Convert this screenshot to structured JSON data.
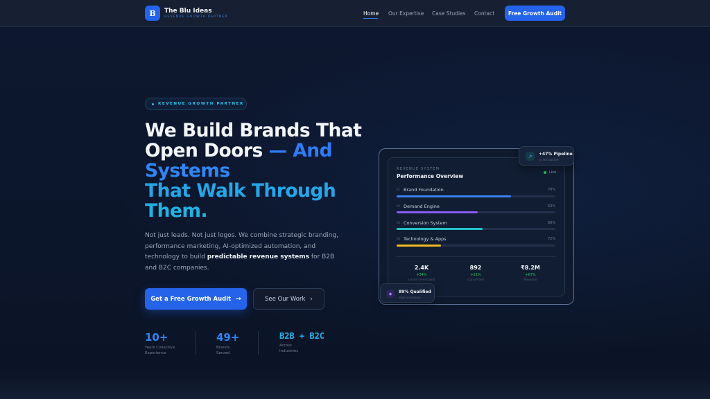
{
  "nav": {
    "logo_letter": "B",
    "brand_name": "The Blu Ideas",
    "brand_tagline": "REVENUE GROWTH PARTNER",
    "links": [
      {
        "label": "Home",
        "active": true
      },
      {
        "label": "Our Expertise",
        "active": false
      },
      {
        "label": "Case Studies",
        "active": false
      },
      {
        "label": "Contact",
        "active": false
      }
    ],
    "cta_label": "Free Growth Audit"
  },
  "hero": {
    "eyebrow": "REVENUE GROWTH PARTNER",
    "headline_line1": "We Build Brands That",
    "headline_line2_a": "Open Doors ",
    "headline_line2_b": "— And",
    "headline_line3": "Systems",
    "headline_line4": "That Walk Through",
    "headline_line5": "Them.",
    "paragraph_a": "Not just leads. Not just logos. We combine strategic branding, performance marketing, AI-optimized automation, and technology to build ",
    "paragraph_bold": "predictable revenue systems",
    "paragraph_b": " for B2B and B2C companies.",
    "primary_cta": "Get a Free Growth Audit",
    "secondary_cta": "See Our Work",
    "arrow_icon": "→",
    "chevron_icon": "›"
  },
  "stats": [
    {
      "value": "10+",
      "label": "Years Collective Experience",
      "color": "#2f86f6"
    },
    {
      "value": "49+",
      "label": "Brands Served",
      "color": "#2f86f6"
    },
    {
      "value": "B2B + B2C",
      "label": "Across Industries",
      "color": "#22b4e8"
    }
  ],
  "card": {
    "eyebrow": "REVENUE SYSTEM",
    "title": "Performance Overview",
    "live_label": "Live",
    "bars": [
      {
        "num": "01",
        "label": "Brand Foundation",
        "pct_label": "78%",
        "value": 0.72,
        "color": "#3b82f6"
      },
      {
        "num": "02",
        "label": "Demand Engine",
        "pct_label": "63%",
        "value": 0.51,
        "color": "#8b5cf6"
      },
      {
        "num": "03",
        "label": "Conversion System",
        "pct_label": "89%",
        "value": 0.54,
        "color": "#22c3c6"
      },
      {
        "num": "04",
        "label": "Technology & Apps",
        "pct_label": "72%",
        "value": 0.28,
        "color": "#f5b81e"
      }
    ],
    "metrics": [
      {
        "value": "2.4K",
        "change": "+34%",
        "label": "Leads Generated"
      },
      {
        "value": "892",
        "change": "+21%",
        "label": "Converted"
      },
      {
        "value": "₹8.2M",
        "change": "+67%",
        "label": "Revenue"
      }
    ],
    "float_top": {
      "title": "+47% Pipeline",
      "subtitle": "vs last quarter",
      "icon": "↗"
    },
    "float_bottom": {
      "title": "89% Qualified",
      "subtitle": "lead conversion",
      "icon": "◆"
    }
  }
}
